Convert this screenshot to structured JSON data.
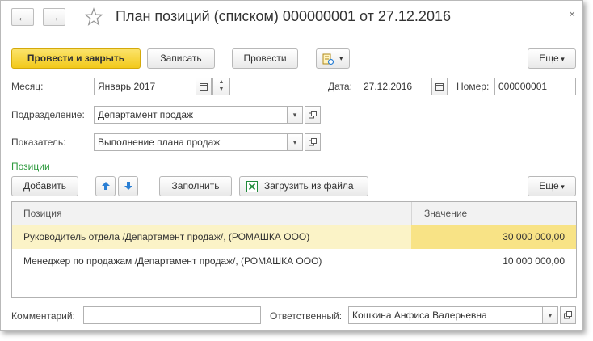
{
  "window": {
    "title": "План позиций (списком) 000000001 от 27.12.2016",
    "back_glyph": "←",
    "forward_glyph": "→",
    "close_glyph": "×"
  },
  "toolbar": {
    "post_close": "Провести и закрыть",
    "save": "Записать",
    "post": "Провести",
    "more": "Еще"
  },
  "fields": {
    "month_label": "Месяц:",
    "month_value": "Январь 2017",
    "date_label": "Дата:",
    "date_value": "27.12.2016",
    "number_label": "Номер:",
    "number_value": "000000001",
    "department_label": "Подразделение:",
    "department_value": "Департамент продаж",
    "indicator_label": "Показатель:",
    "indicator_value": "Выполнение плана продаж"
  },
  "positions": {
    "section_title": "Позиции",
    "add": "Добавить",
    "fill": "Заполнить",
    "load_file": "Загрузить из файла",
    "more": "Еще",
    "columns": [
      "Позиция",
      "Значение"
    ],
    "rows": [
      {
        "position": "Руководитель отдела /Департамент продаж/, (РОМАШКА ООО)",
        "value": "30 000 000,00"
      },
      {
        "position": "Менеджер по продажам /Департамент продаж/, (РОМАШКА ООО)",
        "value": "10 000 000,00"
      }
    ]
  },
  "footer": {
    "comment_label": "Комментарий:",
    "comment_value": "",
    "responsible_label": "Ответственный:",
    "responsible_value": "Кошкина Анфиса Валерьевна"
  },
  "colors": {
    "primary_button": "#f2c91b",
    "section_title": "#2e9a3e",
    "selected_row": "#fbf3c7",
    "selected_cell": "#f8e386",
    "arrow_blue": "#2a7fd4",
    "excel_green": "#1f8a3a"
  },
  "icons": [
    "back-arrow-icon",
    "forward-arrow-icon",
    "star-icon",
    "close-icon",
    "report-icon",
    "calendar-icon",
    "spin-icon",
    "dropdown-icon",
    "open-icon",
    "arrow-up-icon",
    "arrow-down-icon",
    "excel-icon"
  ]
}
